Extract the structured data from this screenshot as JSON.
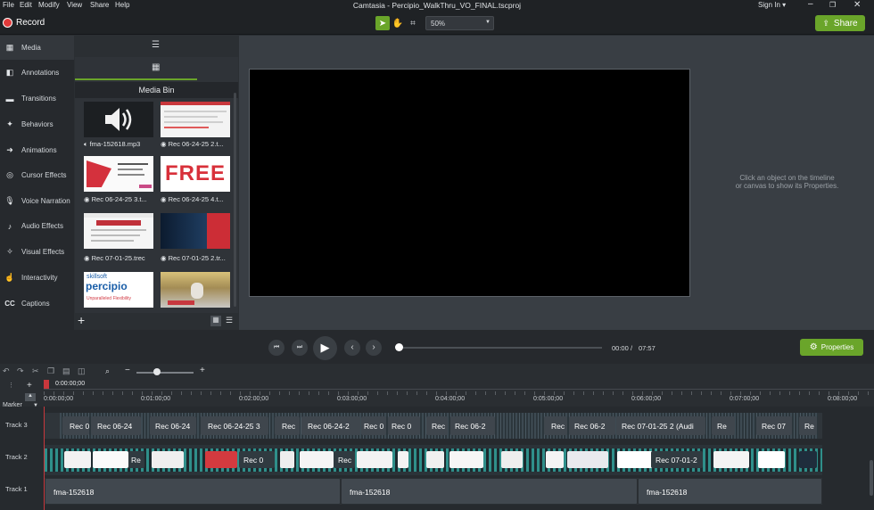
{
  "menu": [
    "File",
    "Edit",
    "Modify",
    "View",
    "Share",
    "Help"
  ],
  "window_title": "Camtasia - Percipio_WalkThru_VO_FINAL.tscproj",
  "sign_in": "Sign In ▾",
  "record_label": "Record",
  "zoom_value": "50%",
  "share_label": "Share",
  "sidebar": [
    {
      "label": "Media",
      "icon": "film-icon"
    },
    {
      "label": "Annotations",
      "icon": "annotation-icon"
    },
    {
      "label": "Transitions",
      "icon": "transition-icon"
    },
    {
      "label": "Behaviors",
      "icon": "behavior-icon"
    },
    {
      "label": "Animations",
      "icon": "animation-icon"
    },
    {
      "label": "Cursor Effects",
      "icon": "cursor-icon"
    },
    {
      "label": "Voice Narration",
      "icon": "microphone-icon"
    },
    {
      "label": "Audio Effects",
      "icon": "audio-icon"
    },
    {
      "label": "Visual Effects",
      "icon": "visual-effects-icon"
    },
    {
      "label": "Interactivity",
      "icon": "interactivity-icon"
    },
    {
      "label": "Captions",
      "icon": "cc-icon"
    }
  ],
  "media_bin_title": "Media Bin",
  "media_items": [
    {
      "label": "fma-152618.mp3",
      "kind": "audio"
    },
    {
      "label": "Rec 06-24-25 2.t...",
      "kind": "screen"
    },
    {
      "label": "Rec 06-24-25 3.t...",
      "kind": "screen-red"
    },
    {
      "label": "Rec 06-24-25 4.t...",
      "kind": "free"
    },
    {
      "label": "Rec 07-01-25.trec",
      "kind": "screen"
    },
    {
      "label": "Rec 07-01-25 2.tr...",
      "kind": "face"
    },
    {
      "label": "",
      "kind": "percipio"
    },
    {
      "label": "",
      "kind": "photo"
    }
  ],
  "percipio_thumb": {
    "brand1": "skillsoft",
    "brand2": "percipio",
    "tagline": "Unparalleled Flexibility"
  },
  "free_text": "FREE",
  "props_hint_line1": "Click an object on the timeline",
  "props_hint_line2": "or canvas to show its Properties.",
  "time_current": "00:00",
  "time_sep": "/",
  "time_total": "07:57",
  "properties_label": "Properties",
  "playhead_time": "0:00:00;00",
  "ruler_ticks": [
    "0:00:00;00",
    "0:01:00;00",
    "0:02:00;00",
    "0:03:00;00",
    "0:04:00;00",
    "0:05:00;00",
    "0:06:00;00",
    "0:07:00;00",
    "0:08:00;00"
  ],
  "marker_label": "Marker",
  "tracks": [
    "Track 3",
    "Track 2",
    "Track 1"
  ],
  "track3_clips": [
    "Rec 0",
    "Rec 06-24",
    "Rec 06-24",
    "Rec 06-24-25 3",
    "Rec",
    "Rec 06-24-2",
    "Rec 0",
    "Rec 0",
    "Rec",
    "Rec 06-2",
    "Rec",
    "Rec 06-2",
    "Rec 07-01-25 2 (Audi",
    "Re",
    "Rec 07",
    "Re"
  ],
  "track2_clips": [
    "Re",
    "Rec 0",
    "Rec",
    "Rec 07-01-2"
  ],
  "track1_clips": [
    "fma-152618",
    "fma-152618",
    "fma-152618"
  ],
  "colors": {
    "accent": "#6aa52a",
    "record": "#e03a3a",
    "audio_clip": "#3f464d",
    "video_clip": "#303a40"
  }
}
